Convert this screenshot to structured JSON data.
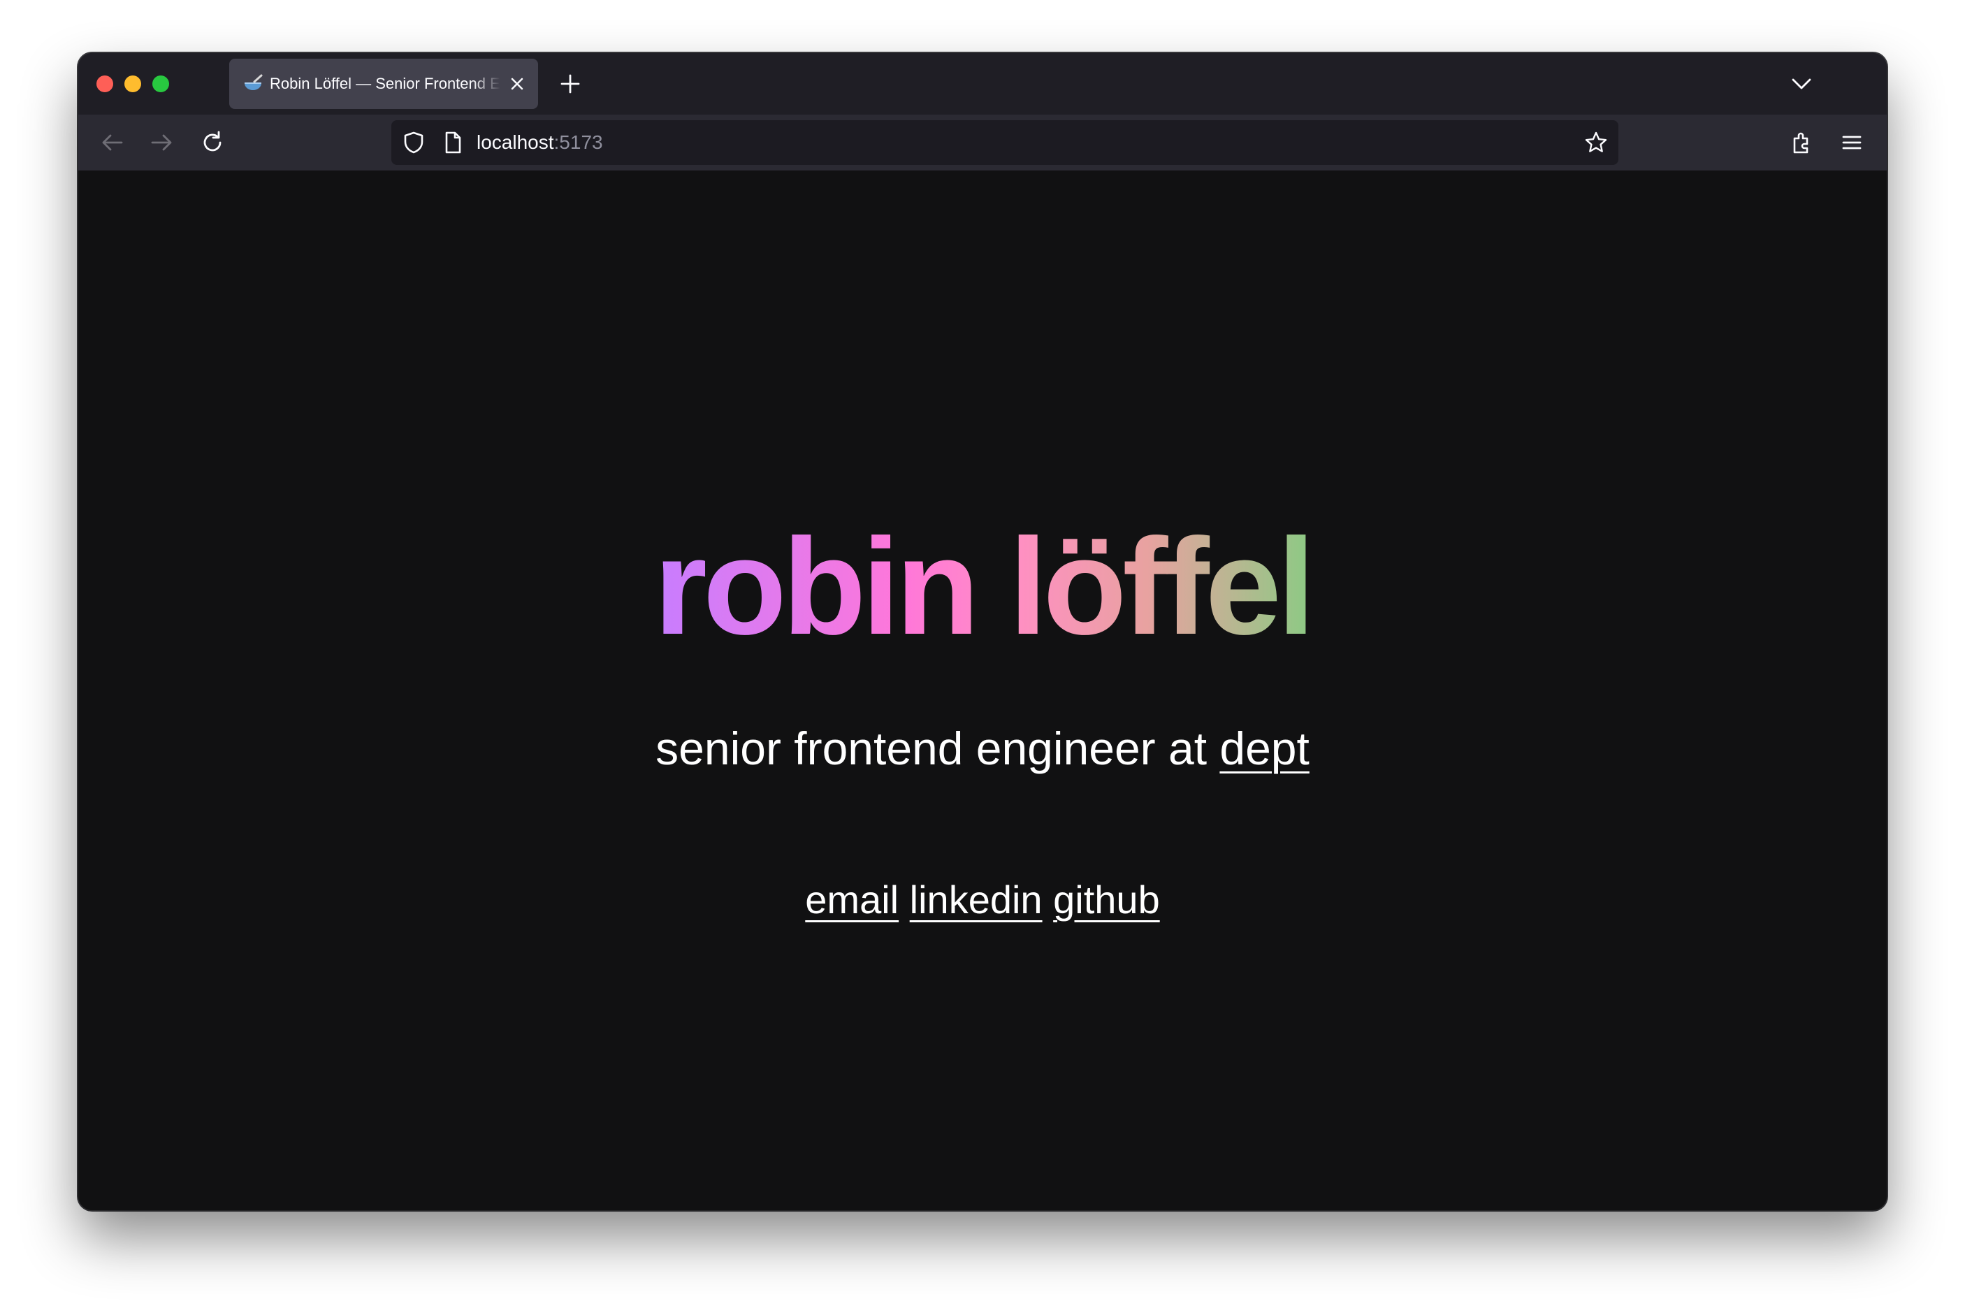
{
  "browser": {
    "tab": {
      "favicon": "bowl-spoon-icon",
      "title": "Robin Löffel — Senior Frontend Engineer"
    },
    "url": {
      "host": "localhost",
      "port": ":5173"
    }
  },
  "page": {
    "name": "robin löffel",
    "tagline_prefix": "senior frontend engineer at ",
    "company_link": "dept",
    "links": {
      "email": "email",
      "linkedin": "linkedin",
      "github": "github"
    }
  },
  "colors": {
    "background": "#111112",
    "text": "#ffffff",
    "gradient": [
      "#c77dff",
      "#ff77d9",
      "#ff8fc3",
      "#e8a2a0",
      "#8cca84"
    ]
  }
}
